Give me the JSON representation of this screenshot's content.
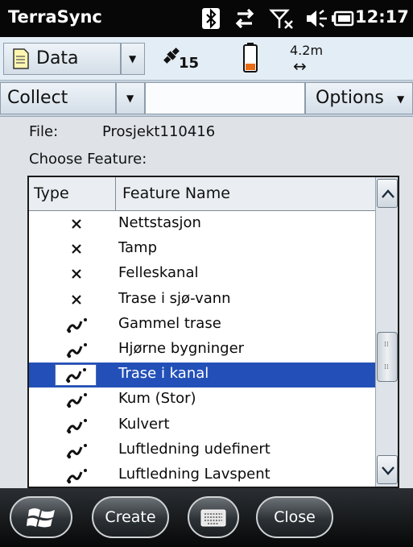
{
  "titlebar": {
    "app_name": "TerraSync",
    "time": "12:17"
  },
  "toolbar": {
    "section": "Data",
    "satellites": "15",
    "accuracy": "4.2m"
  },
  "subtoolbar": {
    "mode": "Collect",
    "options": "Options"
  },
  "file_row": {
    "label": "File:",
    "value": "Prosjekt110416"
  },
  "choose_label": "Choose Feature:",
  "list": {
    "headers": {
      "type": "Type",
      "name": "Feature Name"
    },
    "rows": [
      {
        "icon": "point-x-icon",
        "name": "Nettstasjon",
        "selected": false
      },
      {
        "icon": "point-x-icon",
        "name": "Tamp",
        "selected": false
      },
      {
        "icon": "point-x-icon",
        "name": "Felleskanal",
        "selected": false
      },
      {
        "icon": "point-x-icon",
        "name": "Trase i sjø-vann",
        "selected": false
      },
      {
        "icon": "line-feature-icon",
        "name": "Gammel trase",
        "selected": false
      },
      {
        "icon": "line-feature-icon",
        "name": "Hjørne bygninger",
        "selected": false
      },
      {
        "icon": "line-feature-icon",
        "name": "Trase i kanal",
        "selected": true
      },
      {
        "icon": "line-feature-icon",
        "name": "Kum (Stor)",
        "selected": false
      },
      {
        "icon": "line-feature-icon",
        "name": "Kulvert",
        "selected": false
      },
      {
        "icon": "line-feature-icon",
        "name": "Luftledning udefinert",
        "selected": false
      },
      {
        "icon": "line-feature-icon",
        "name": "Luftledning Lavspent",
        "selected": false
      }
    ]
  },
  "bottom": {
    "create": "Create",
    "close": "Close"
  },
  "colors": {
    "selection": "#2350b8",
    "titlebar": "#070707",
    "toolbar": "#e3edf5"
  }
}
